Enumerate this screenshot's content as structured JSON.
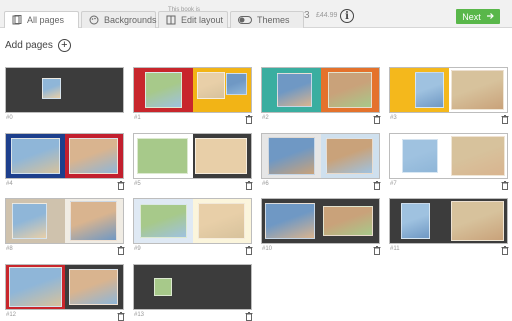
{
  "header": {
    "tabs": [
      {
        "label": "All pages",
        "icon": "pages-icon"
      },
      {
        "label": "Backgrounds",
        "icon": "palette-icon"
      },
      {
        "label": "Edit layout",
        "icon": "layout-icon"
      },
      {
        "label": "Themes",
        "icon": "toggle-icon"
      }
    ],
    "book_info": "This book is",
    "page_count_hint": "3",
    "price": "£44.99",
    "info_symbol": "i",
    "next_label": "Next"
  },
  "add_pages_label": "Add pages",
  "spreads": [
    {
      "label": "#0",
      "colors": [
        "#3c3c3c",
        "#3c3c3c"
      ],
      "has_trash": false
    },
    {
      "label": "#1",
      "colors": [
        "#c8262c",
        "#f2b416"
      ],
      "has_trash": true
    },
    {
      "label": "#2",
      "colors": [
        "#3aaea0",
        "#e4722c"
      ],
      "has_trash": true
    },
    {
      "label": "#3",
      "colors": [
        "#f4b81c",
        "#ffffff"
      ],
      "has_trash": true
    },
    {
      "label": "#4",
      "colors": [
        "#1d3f8c",
        "#c21f2e"
      ],
      "has_trash": true
    },
    {
      "label": "#5",
      "colors": [
        "#ffffff",
        "#3c3c3c"
      ],
      "has_trash": true
    },
    {
      "label": "#6",
      "colors": [
        "#e6e6e6",
        "#cfe0ee"
      ],
      "has_trash": true
    },
    {
      "label": "#7",
      "colors": [
        "#ffffff",
        "#ffffff"
      ],
      "has_trash": true
    },
    {
      "label": "#8",
      "colors": [
        "#cfc2ad",
        "#f0ece4"
      ],
      "has_trash": true
    },
    {
      "label": "#9",
      "colors": [
        "#dfe9f4",
        "#fbf5dc"
      ],
      "has_trash": true
    },
    {
      "label": "#10",
      "colors": [
        "#3c3c3c",
        "#3c3c3c"
      ],
      "has_trash": true
    },
    {
      "label": "#11",
      "colors": [
        "#3c3c3c",
        "#3c3c3c"
      ],
      "has_trash": true
    },
    {
      "label": "#12",
      "colors": [
        "#c8262c",
        "#3c3c3c"
      ],
      "has_trash": true
    },
    {
      "label": "#13",
      "colors": [
        "#3c3c3c",
        "#3c3c3c"
      ],
      "has_trash": true
    }
  ]
}
